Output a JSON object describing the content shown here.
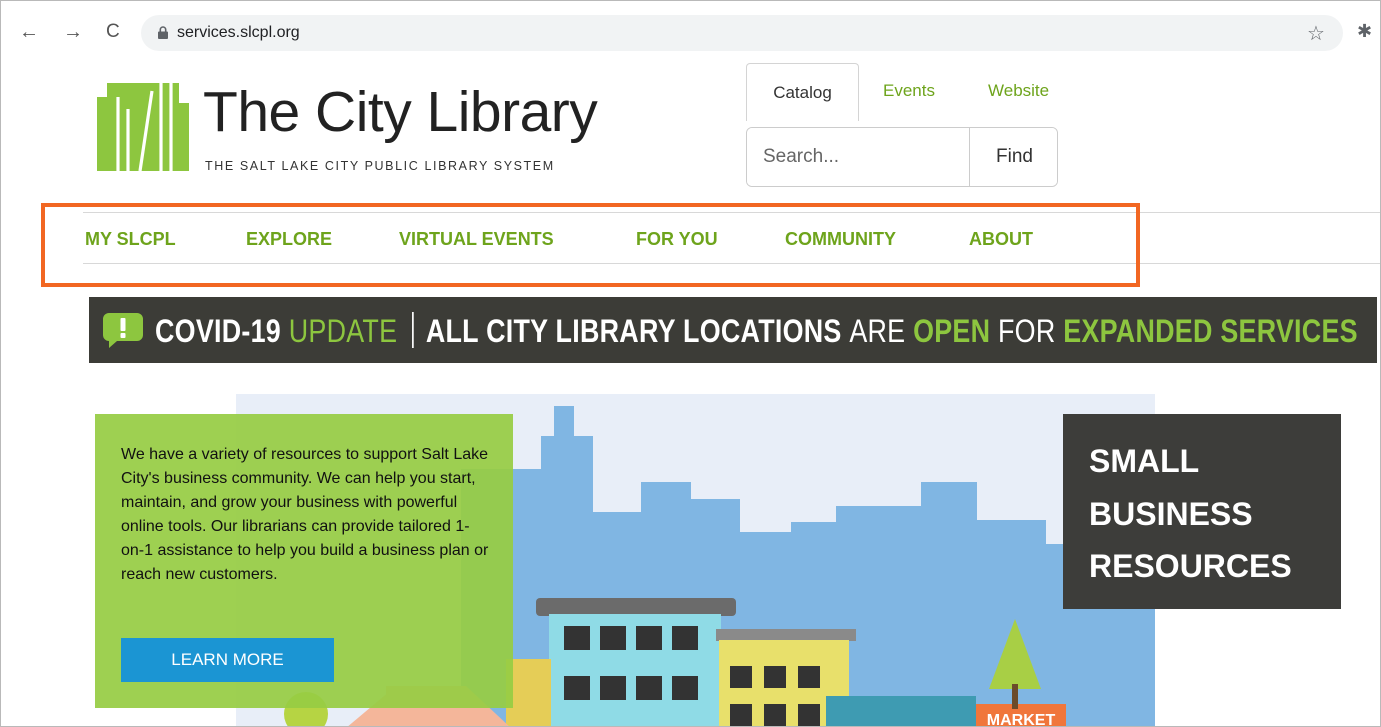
{
  "browser": {
    "back_icon": "←",
    "forward_icon": "→",
    "reload_icon": "C",
    "url": "services.slcpl.org",
    "star_icon": "☆",
    "extension_icon": "✱"
  },
  "header": {
    "logo_title": "The City Library",
    "logo_subtitle": "THE SALT LAKE CITY PUBLIC LIBRARY SYSTEM",
    "tabs": {
      "catalog": "Catalog",
      "events": "Events",
      "website": "Website"
    },
    "search": {
      "placeholder": "Search...",
      "button_label": "Find"
    }
  },
  "nav": {
    "items": [
      {
        "label": "MY SLCPL"
      },
      {
        "label": "EXPLORE"
      },
      {
        "label": "VIRTUAL EVENTS"
      },
      {
        "label": "FOR YOU"
      },
      {
        "label": "COMMUNITY"
      },
      {
        "label": "ABOUT"
      }
    ]
  },
  "banner": {
    "covid": "COVID-19",
    "update": "UPDATE",
    "all_locations": "ALL CITY LIBRARY LOCATIONS",
    "are": "ARE",
    "open": "OPEN",
    "for": "FOR",
    "expanded": "EXPANDED SERVICES"
  },
  "hero": {
    "description": "We have a variety of resources to support Salt Lake City's business community. We can help you start, maintain, and grow your business with powerful online tools. Our librarians can provide tailored 1-on-1 assistance to help you build a business plan or reach new customers.",
    "button_label": "LEARN MORE",
    "title_lines": [
      "SMALL",
      "BUSINESS",
      "RESOURCES"
    ],
    "market_sign": "MARKET"
  },
  "colors": {
    "brand_green": "#8dc63f",
    "nav_green": "#6ea41c",
    "highlight_orange": "#f26722",
    "button_blue": "#1b95d3",
    "banner_dark": "#3c3c37"
  }
}
